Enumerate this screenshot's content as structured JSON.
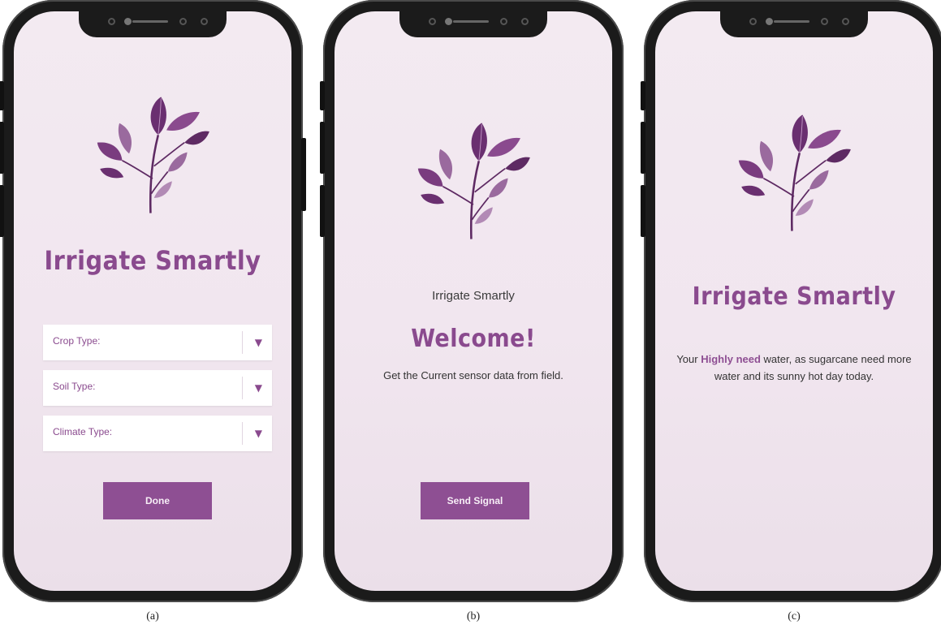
{
  "screens": {
    "a": {
      "title": "Irrigate Smartly",
      "dropdowns": [
        {
          "label": "Crop Type:"
        },
        {
          "label": "Soil Type:"
        },
        {
          "label": "Climate Type:"
        }
      ],
      "done_label": "Done",
      "caption": "(a)"
    },
    "b": {
      "app_name": "Irrigate Smartly",
      "welcome": "Welcome!",
      "message": "Get the Current sensor data from field.",
      "send_label": "Send Signal",
      "caption": "(b)"
    },
    "c": {
      "title": "Irrigate Smartly",
      "msg_prefix": "Your",
      "msg_highlight": "Highly need",
      "msg_rest": "water, as sugarcane need more water and its sunny hot day today.",
      "caption": "(c)"
    }
  },
  "icons": {
    "logo": "plant-leaves-icon",
    "dropdown_caret": "triangle-down-icon"
  },
  "colors": {
    "accent": "#8e4f93",
    "title": "#8a4a8e",
    "screen_bg": "#f3eaf1",
    "phone_frame": "#1b1b1b"
  }
}
